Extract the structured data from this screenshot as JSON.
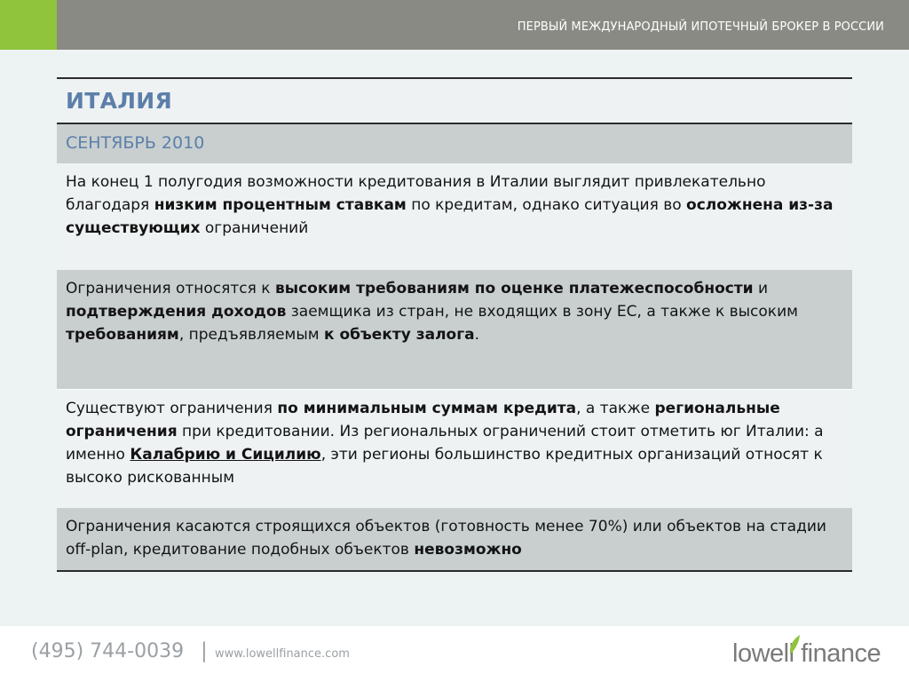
{
  "header": {
    "title": "ПЕРВЫЙ МЕЖДУНАРОДНЫЙ ИПОТЕЧНЫЙ БРОКЕР В РОССИИ"
  },
  "slide": {
    "title": "ИТАЛИЯ",
    "subtitle": "СЕНТЯБРЬ 2010"
  },
  "rows": [
    [
      {
        "t": "На конец 1 полугодия возможности кредитования в Италии выглядит привлекательно благодаря "
      },
      {
        "t": "низким процентным ставкам",
        "b": true
      },
      {
        "t": " по кредитам, однако ситуация во "
      },
      {
        "t": "осложнена из-за существующих",
        "b": true
      },
      {
        "t": " ограничений"
      }
    ],
    [
      {
        "t": "Ограничения относятся к "
      },
      {
        "t": "высоким требованиям по оценке платежеспособности",
        "b": true
      },
      {
        "t": " и "
      },
      {
        "t": "подтверждения доходов",
        "b": true
      },
      {
        "t": " заемщика из стран, не входящих в зону ЕС, а также к высоким "
      },
      {
        "t": "требованиям",
        "b": true
      },
      {
        "t": ", предъявляемым "
      },
      {
        "t": "к объекту залога",
        "b": true
      },
      {
        "t": "."
      }
    ],
    [
      {
        "t": "Существуют ограничения "
      },
      {
        "t": "по минимальным суммам кредита",
        "b": true
      },
      {
        "t": ", а также "
      },
      {
        "t": "региональные ограничения",
        "b": true
      },
      {
        "t": " при кредитовании.  Из региональных ограничений стоит отметить юг Италии: а именно "
      },
      {
        "t": "Калабрию и Сицилию",
        "b": true,
        "u": true
      },
      {
        "t": ", эти регионы большинство кредитных организаций относят к высоко рискованным"
      }
    ],
    [
      {
        "t": "Ограничения касаются строящихся объектов (готовность менее 70%) или объектов на стадии off-plan, кредитование подобных объектов "
      },
      {
        "t": "невозможно",
        "b": true
      }
    ]
  ],
  "footer": {
    "phone": "(495) 744-0039",
    "separator": "|",
    "website": "www.lowellfinance.com",
    "logo_text": "lowell finance",
    "logo_icon": "leaf-icon",
    "accent_color": "#8fc43c"
  }
}
